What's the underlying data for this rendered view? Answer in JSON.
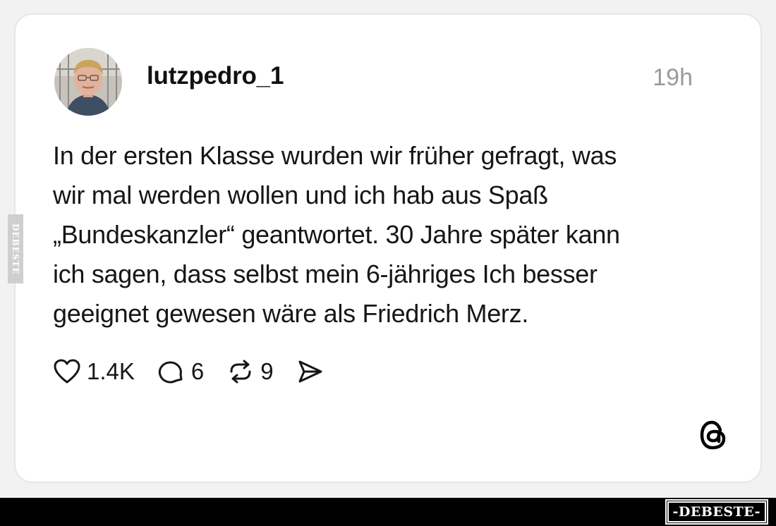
{
  "post": {
    "username": "lutzpedro_1",
    "time": "19h",
    "text_lines": [
      "In der ersten Klasse wurden wir früher gefragt, was",
      "wir mal werden wollen und ich hab aus Spaß",
      "„Bundeskanzler“ geantwortet. 30 Jahre später kann",
      "ich sagen, dass selbst mein 6-jähriges Ich besser",
      "geeignet gewesen wäre als Friedrich Merz."
    ]
  },
  "actions": {
    "likes": "1.4K",
    "comments": "6",
    "reposts": "9"
  },
  "icons": {
    "like": "heart-icon",
    "comment": "speech-bubble-icon",
    "repost": "repost-arrows-icon",
    "share": "send-icon",
    "brand": "threads-logo-icon"
  },
  "watermark": {
    "side": "DEBESTE",
    "bottom": "-DEBESTE-"
  },
  "colors": {
    "background": "#f2f2f2",
    "card": "#ffffff",
    "text": "#161616",
    "muted": "#9a9a9a"
  }
}
